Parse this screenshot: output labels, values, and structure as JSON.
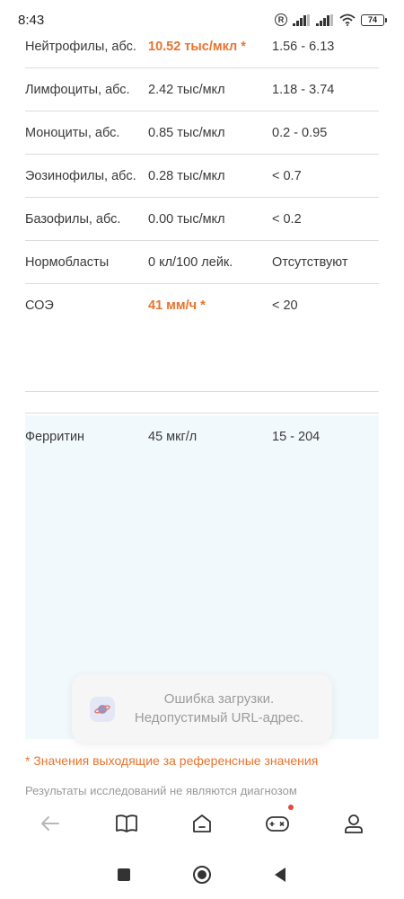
{
  "status_bar": {
    "time": "8:43",
    "reg_badge": "R",
    "battery": "74",
    "icons": [
      "registered-icon",
      "signal-icon",
      "signal-icon",
      "wifi-icon",
      "battery-icon"
    ]
  },
  "results": [
    {
      "name": "Нейтрофилы, абс.",
      "value": "10.52 тыс/мкл *",
      "ref": "1.56 - 6.13",
      "abnormal": true
    },
    {
      "name": "Лимфоциты, абс.",
      "value": "2.42 тыс/мкл",
      "ref": "1.18 - 3.74",
      "abnormal": false
    },
    {
      "name": "Моноциты, абс.",
      "value": "0.85 тыс/мкл",
      "ref": "0.2 - 0.95",
      "abnormal": false
    },
    {
      "name": "Эозинофилы, абс.",
      "value": "0.28 тыс/мкл",
      "ref": "< 0.7",
      "abnormal": false
    },
    {
      "name": "Базофилы, абс.",
      "value": "0.00 тыс/мкл",
      "ref": "< 0.2",
      "abnormal": false
    },
    {
      "name": "Нормобласты",
      "value": "0 кл/100 лейк.",
      "ref": "Отсутствуют",
      "abnormal": false
    },
    {
      "name": "СОЭ",
      "value": "41 мм/ч *",
      "ref": "< 20",
      "abnormal": true
    }
  ],
  "ferritin": {
    "name": "Ферритин",
    "value": "45 мкг/л",
    "ref": "15 - 204"
  },
  "note": "* Значения выходящие за референсные значения",
  "disclaimer": "Результаты исследований не являются диагнозом",
  "toast": {
    "line1": "Ошибка загрузки.",
    "line2": "Недопустимый URL-адрес.",
    "icon": "app-planet-icon"
  },
  "bottom_nav": {
    "items": [
      "back-arrow-icon",
      "book-icon",
      "home-icon",
      "gamepad-icon",
      "profile-icon"
    ],
    "badge_color": "#e8453c"
  },
  "system_nav": [
    "recents-square-icon",
    "home-circle-icon",
    "back-triangle-icon"
  ],
  "colors": {
    "accent": "#e8732d",
    "ferritin_bg": "#f2f9fd",
    "divider": "#dcdcdc"
  }
}
